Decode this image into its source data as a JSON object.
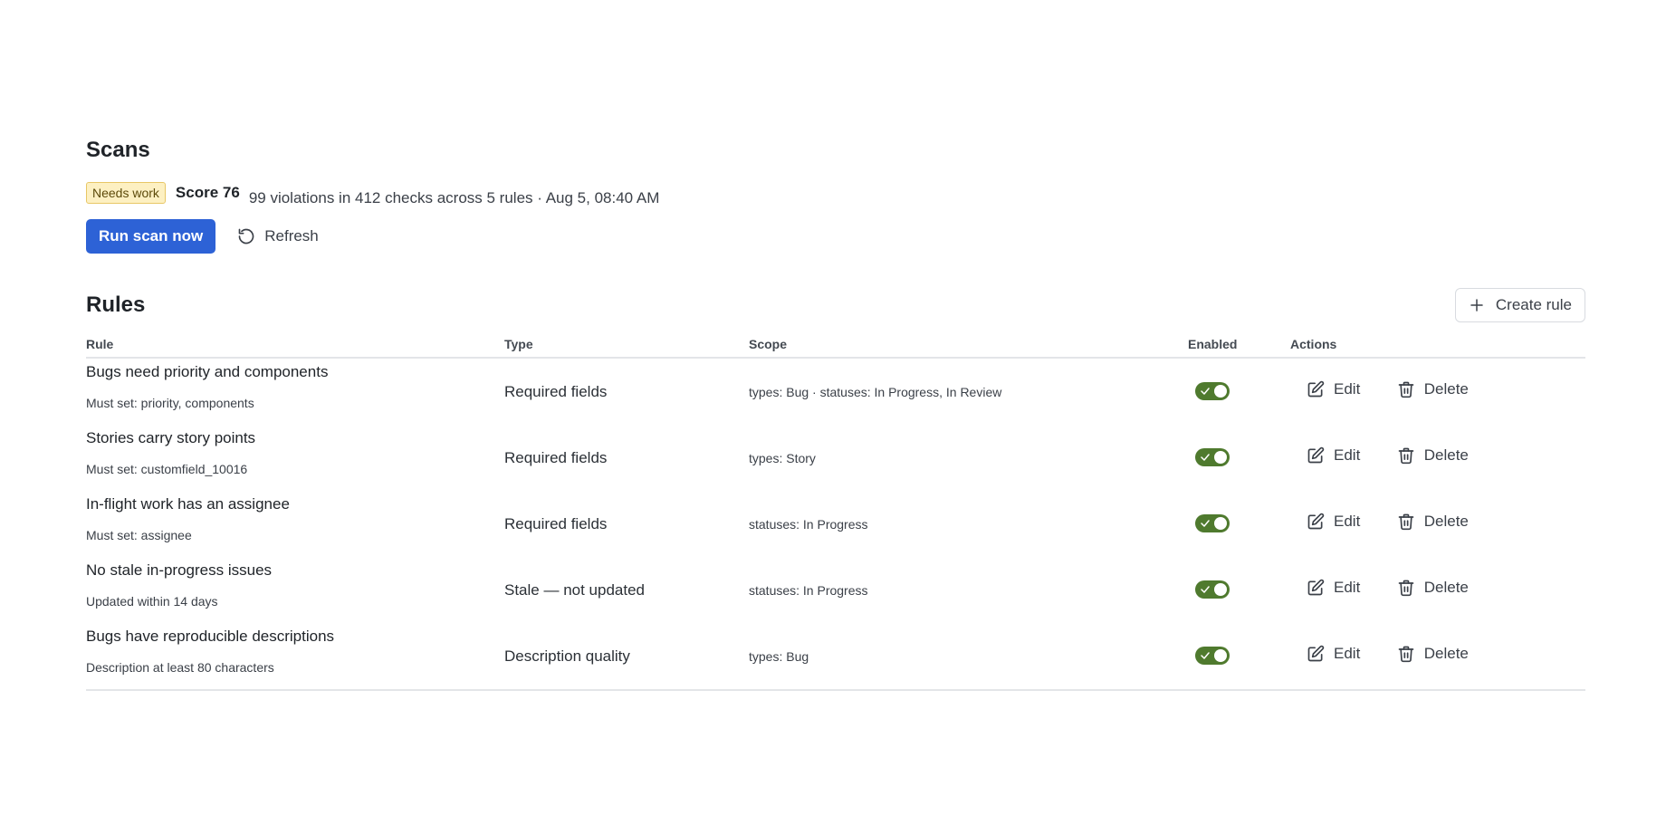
{
  "scans": {
    "title": "Scans",
    "badge": "Needs work",
    "score": "Score 76",
    "summary": "99 violations in 412 checks across 5 rules · Aug 5, 08:40 AM",
    "run_label": "Run scan now",
    "refresh_label": "Refresh"
  },
  "rules": {
    "title": "Rules",
    "create_label": "Create rule",
    "columns": {
      "rule": "Rule",
      "type": "Type",
      "scope": "Scope",
      "enabled": "Enabled",
      "actions": "Actions"
    },
    "edit_label": "Edit",
    "delete_label": "Delete",
    "rows": [
      {
        "name": "Bugs need priority and components",
        "desc": "Must set: priority, components",
        "type": "Required fields",
        "scope": "types: Bug · statuses: In Progress, In Review",
        "enabled": true
      },
      {
        "name": "Stories carry story points",
        "desc": "Must set: customfield_10016",
        "type": "Required fields",
        "scope": "types: Story",
        "enabled": true
      },
      {
        "name": "In-flight work has an assignee",
        "desc": "Must set: assignee",
        "type": "Required fields",
        "scope": "statuses: In Progress",
        "enabled": true
      },
      {
        "name": "No stale in-progress issues",
        "desc": "Updated within 14 days",
        "type": "Stale — not updated",
        "scope": "statuses: In Progress",
        "enabled": true
      },
      {
        "name": "Bugs have reproducible descriptions",
        "desc": "Description at least 80 characters",
        "type": "Description quality",
        "scope": "types: Bug",
        "enabled": true
      }
    ]
  },
  "colors": {
    "primary": "#2d62d6",
    "toggle_on": "#4f7a2e",
    "badge_bg": "#fdf0c2"
  }
}
